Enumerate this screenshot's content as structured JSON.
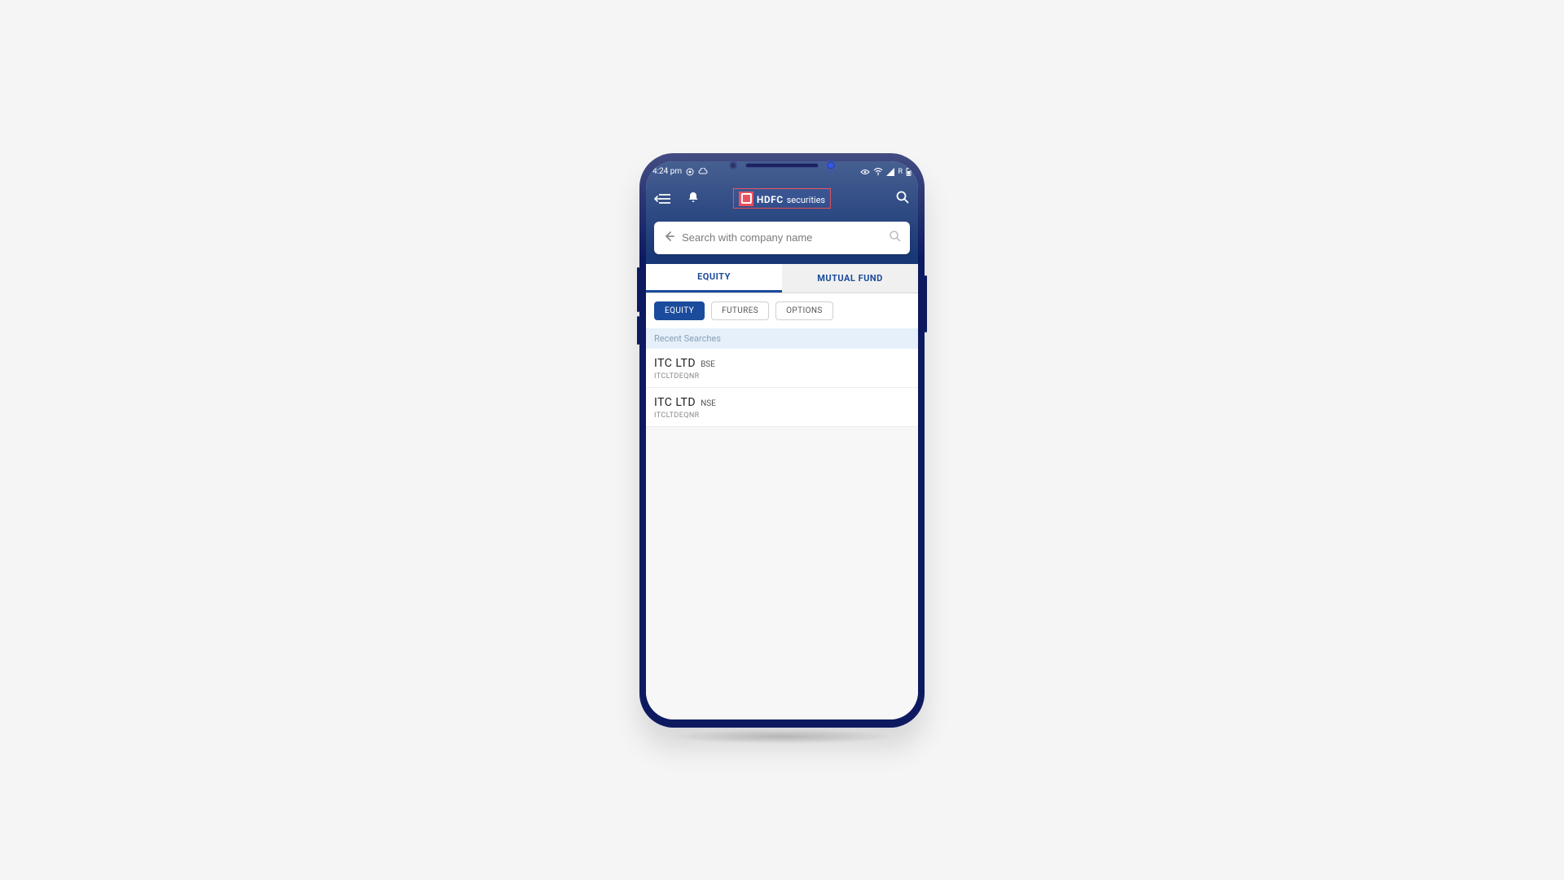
{
  "status": {
    "time": "4:24 pm",
    "network_label": "R"
  },
  "header": {
    "brand_primary": "HDFC",
    "brand_secondary": "securities"
  },
  "search": {
    "placeholder": "Search with company name",
    "value": ""
  },
  "main_tabs": [
    {
      "label": "EQUITY",
      "active": true
    },
    {
      "label": "MUTUAL FUND",
      "active": false
    }
  ],
  "sub_tabs": [
    {
      "label": "EQUITY",
      "active": true
    },
    {
      "label": "FUTURES",
      "active": false
    },
    {
      "label": "OPTIONS",
      "active": false
    }
  ],
  "recent_header": "Recent Searches",
  "recent": [
    {
      "name": "ITC LTD",
      "exchange": "BSE",
      "code": "ITCLTDEQNR"
    },
    {
      "name": "ITC LTD",
      "exchange": "NSE",
      "code": "ITCLTDEQNR"
    }
  ]
}
